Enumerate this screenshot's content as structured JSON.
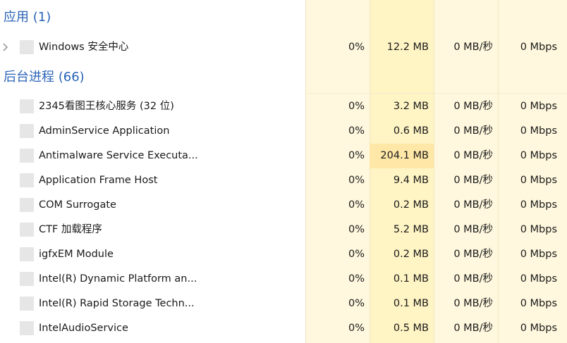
{
  "groups": {
    "apps": {
      "label": "应用 (1)",
      "rows": [
        {
          "name": "Windows 安全中心",
          "cpu": "0%",
          "memory": "12.2 MB",
          "disk": "0 MB/秒",
          "network": "0 Mbps"
        }
      ]
    },
    "background": {
      "label": "后台进程 (66)",
      "rows": [
        {
          "name": "2345看图王核心服务 (32 位)",
          "cpu": "0%",
          "memory": "3.2 MB",
          "disk": "0 MB/秒",
          "network": "0 Mbps"
        },
        {
          "name": "AdminService Application",
          "cpu": "0%",
          "memory": "0.6 MB",
          "disk": "0 MB/秒",
          "network": "0 Mbps"
        },
        {
          "name": "Antimalware Service Executa...",
          "cpu": "0%",
          "memory": "204.1 MB",
          "disk": "0 MB/秒",
          "network": "0 Mbps"
        },
        {
          "name": "Application Frame Host",
          "cpu": "0%",
          "memory": "9.4 MB",
          "disk": "0 MB/秒",
          "network": "0 Mbps"
        },
        {
          "name": "COM Surrogate",
          "cpu": "0%",
          "memory": "0.2 MB",
          "disk": "0 MB/秒",
          "network": "0 Mbps"
        },
        {
          "name": "CTF 加载程序",
          "cpu": "0%",
          "memory": "5.2 MB",
          "disk": "0 MB/秒",
          "network": "0 Mbps"
        },
        {
          "name": "igfxEM Module",
          "cpu": "0%",
          "memory": "0.2 MB",
          "disk": "0 MB/秒",
          "network": "0 Mbps"
        },
        {
          "name": "Intel(R) Dynamic Platform an...",
          "cpu": "0%",
          "memory": "0.1 MB",
          "disk": "0 MB/秒",
          "network": "0 Mbps"
        },
        {
          "name": "Intel(R) Rapid Storage Techn...",
          "cpu": "0%",
          "memory": "0.1 MB",
          "disk": "0 MB/秒",
          "network": "0 Mbps"
        },
        {
          "name": "IntelAudioService",
          "cpu": "0%",
          "memory": "0.5 MB",
          "disk": "0 MB/秒",
          "network": "0 Mbps"
        }
      ]
    }
  },
  "icons": {
    "expander": "chevron-right-icon",
    "process": "app-icon"
  },
  "colors": {
    "group_label": "#2a63b8",
    "column_bg": "#fff8de",
    "memory_bg": "#fff4c4",
    "memory_hot": "#ffe7a8"
  }
}
